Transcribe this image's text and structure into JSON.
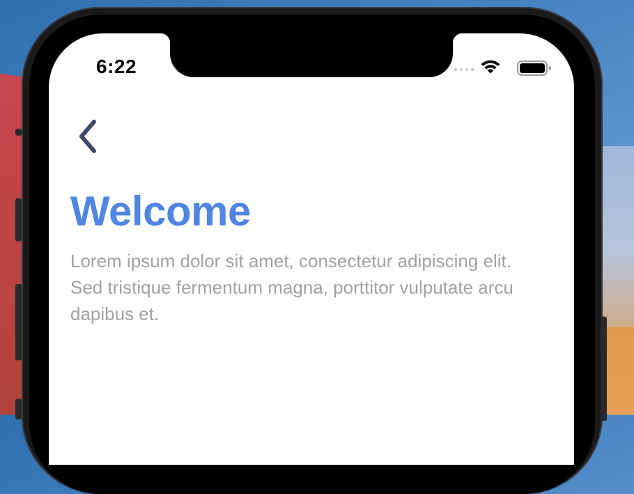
{
  "status_bar": {
    "time": "6:22",
    "icons": [
      "cellular-signal-icon",
      "wifi-icon",
      "battery-icon"
    ]
  },
  "navigation": {
    "back_icon": "chevron-left-icon"
  },
  "content": {
    "title": "Welcome",
    "body": "Lorem ipsum dolor sit amet, consectetur adipiscing elit. Sed tristique fermentum magna, porttitor vulputate arcu dapibus et."
  },
  "colors": {
    "title": "#4f85e3",
    "body_text": "#a1a1a6",
    "back_icon": "#3c4a6b",
    "screen_background": "#ffffff"
  }
}
